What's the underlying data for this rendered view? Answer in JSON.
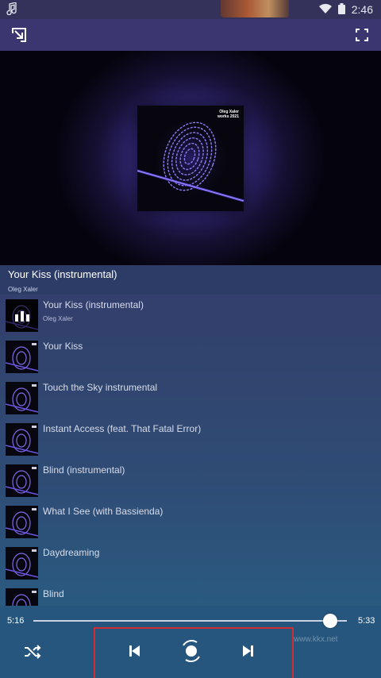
{
  "statusbar": {
    "time": "2:46",
    "music_icon": "music-note-icon",
    "wifi_icon": "wifi-icon",
    "battery_icon": "battery-icon"
  },
  "topbar": {
    "left_icon": "minimize-arrow-icon",
    "right_icon": "fullscreen-icon"
  },
  "artwork": {
    "label_line1": "Oleg Xaler",
    "label_line2": "works 2021"
  },
  "now_playing": {
    "title": "Your Kiss (instrumental)",
    "artist": "Oleg Xaler"
  },
  "playlist": {
    "items": [
      {
        "title": "Your Kiss (instrumental)",
        "artist": "Oleg Xaler",
        "current": true
      },
      {
        "title": "Your Kiss",
        "artist": ""
      },
      {
        "title": "Touch the Sky instrumental",
        "artist": ""
      },
      {
        "title": "Instant Access (feat. That Fatal Error)",
        "artist": ""
      },
      {
        "title": "Blind (instrumental)",
        "artist": ""
      },
      {
        "title": "What I See (with Bassienda)",
        "artist": ""
      },
      {
        "title": "Daydreaming",
        "artist": ""
      },
      {
        "title": "Blind",
        "artist": ""
      }
    ]
  },
  "player": {
    "elapsed": "5:16",
    "duration": "5:33",
    "progress_fraction": 0.948,
    "controls": [
      "shuffle-icon",
      "previous-icon",
      "play-pause-icon",
      "next-icon"
    ]
  },
  "watermark": "www.kkx.net",
  "colors": {
    "accent": "#3b3570",
    "highlight_box": "#d02c34"
  }
}
